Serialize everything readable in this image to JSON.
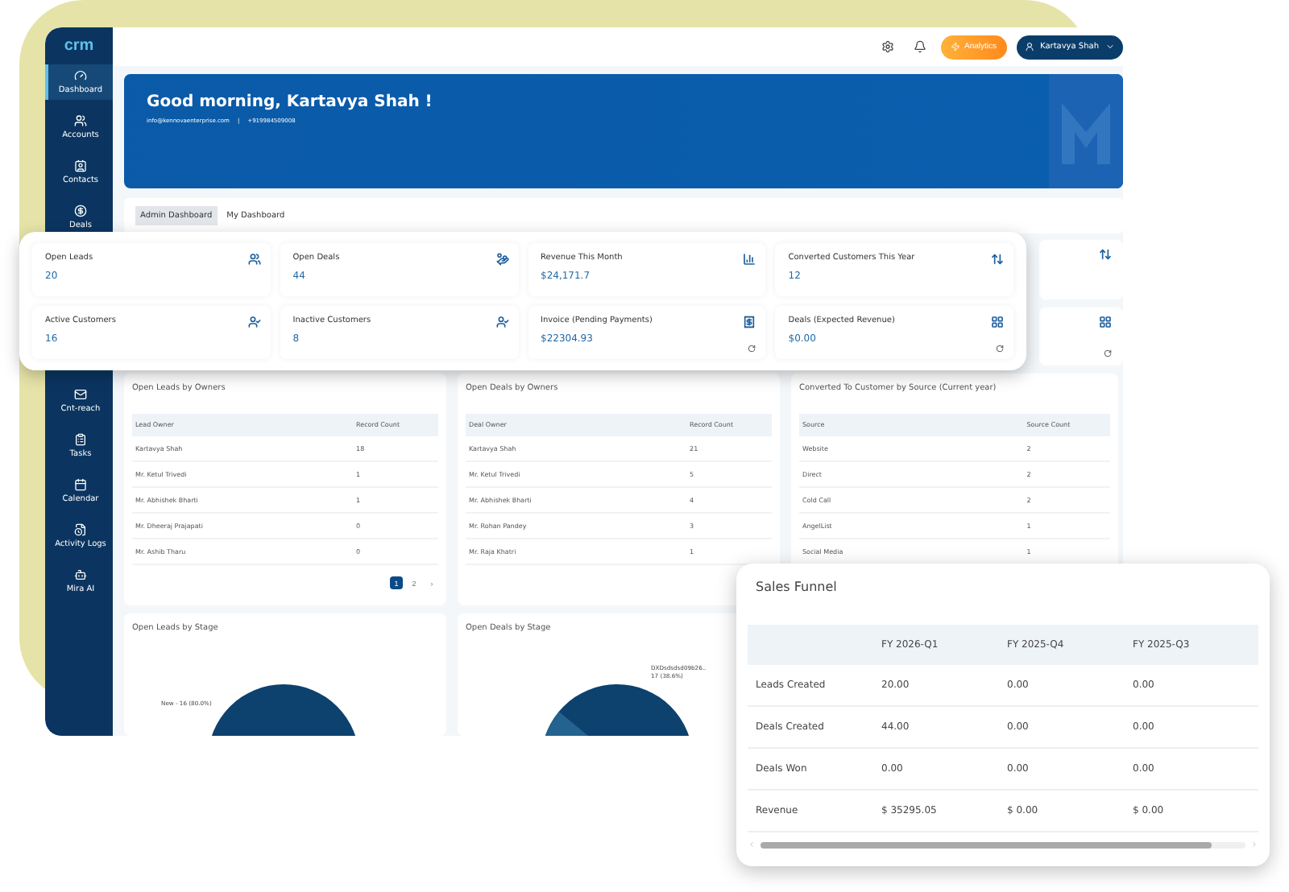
{
  "logo": "crm",
  "sidebar": {
    "items": [
      {
        "label": "Dashboard",
        "selected": true
      },
      {
        "label": "Accounts",
        "selected": false
      },
      {
        "label": "Contacts",
        "selected": false
      },
      {
        "label": "Deals",
        "selected": false
      }
    ],
    "lower_items": [
      {
        "label": "Cnt-reach",
        "selected": false
      },
      {
        "label": "Tasks",
        "selected": false
      },
      {
        "label": "Calendar",
        "selected": false
      },
      {
        "label": "Activity Logs",
        "selected": false
      },
      {
        "label": "Mira AI",
        "selected": false
      }
    ]
  },
  "top_bar": {
    "action_button": "Analytics",
    "user": "Kartavya Shah"
  },
  "banner": {
    "greeting": "Good morning, Kartavya Shah !",
    "email": "info@kennovaenterprise.com",
    "separator": "|",
    "phone": "+919984509008"
  },
  "tabs": [
    {
      "label": "Admin Dashboard",
      "selected": true
    },
    {
      "label": "My Dashboard",
      "selected": false
    }
  ],
  "stats": [
    {
      "label": "Open Leads",
      "value": "20",
      "refresh": false
    },
    {
      "label": "Open Deals",
      "value": "44",
      "refresh": false
    },
    {
      "label": "Revenue This Month",
      "value": "$24,171.7",
      "refresh": false
    },
    {
      "label": "Converted Customers This Year",
      "value": "12",
      "refresh": false
    },
    {
      "label": "Active Customers",
      "value": "16",
      "refresh": false
    },
    {
      "label": "Inactive Customers",
      "value": "8",
      "refresh": false
    },
    {
      "label": "Invoice (Pending Payments)",
      "value": "$22304.93",
      "refresh": true
    },
    {
      "label": "Deals (Expected Revenue)",
      "value": "$0.00",
      "refresh": true
    }
  ],
  "hidden_stats": [
    {
      "refresh": false
    },
    {
      "refresh": true
    }
  ],
  "tables": [
    {
      "title": "Open Leads by Owners",
      "columns": [
        "Lead Owner",
        "Record Count"
      ],
      "rows": [
        [
          "Kartavya Shah",
          "18"
        ],
        [
          "Mr. Ketul Trivedi",
          "1"
        ],
        [
          "Mr. Abhishek Bharti",
          "1"
        ],
        [
          "Mr. Dheeraj Prajapati",
          "0"
        ],
        [
          "Mr. Ashib Tharu",
          "0"
        ]
      ],
      "pages": [
        {
          "label": "1",
          "selected": true
        },
        {
          "label": "2",
          "selected": false
        }
      ],
      "next": "›"
    },
    {
      "title": "Open Deals by Owners",
      "columns": [
        "Deal Owner",
        "Record Count"
      ],
      "rows": [
        [
          "Kartavya Shah",
          "21"
        ],
        [
          "Mr. Ketul Trivedi",
          "5"
        ],
        [
          "Mr. Abhishek Bharti",
          "4"
        ],
        [
          "Mr. Rohan Pandey",
          "3"
        ],
        [
          "Mr. Raja Khatri",
          "1"
        ]
      ]
    },
    {
      "title": "Converted To Customer by Source (Current year)",
      "columns": [
        "Source",
        "Source Count"
      ],
      "rows": [
        [
          "Website",
          "2"
        ],
        [
          "Direct",
          "2"
        ],
        [
          "Cold Call",
          "2"
        ],
        [
          "AngelList",
          "1"
        ],
        [
          "Social Media",
          "1"
        ]
      ]
    }
  ],
  "charts": [
    {
      "title": "Open Leads by Stage",
      "labels": [
        "New - 16 (80.0%)"
      ]
    },
    {
      "title": "Open Deals by Stage",
      "labels": [
        "DXDsdsdsd09b26..",
        "17 (38.6%)"
      ]
    }
  ],
  "sales_funnel": {
    "title": "Sales Funnel",
    "columns": [
      "FY 2026-Q1",
      "FY 2025-Q4",
      "FY 2025-Q3"
    ],
    "rows": [
      {
        "label": "Leads Created",
        "values": [
          "20.00",
          "0.00",
          "0.00"
        ]
      },
      {
        "label": "Deals Created",
        "values": [
          "44.00",
          "0.00",
          "0.00"
        ]
      },
      {
        "label": "Deals Won",
        "values": [
          "0.00",
          "0.00",
          "0.00"
        ]
      },
      {
        "label": "Revenue",
        "values": [
          "$ 35295.05",
          "$ 0.00",
          "$ 0.00"
        ]
      }
    ]
  }
}
